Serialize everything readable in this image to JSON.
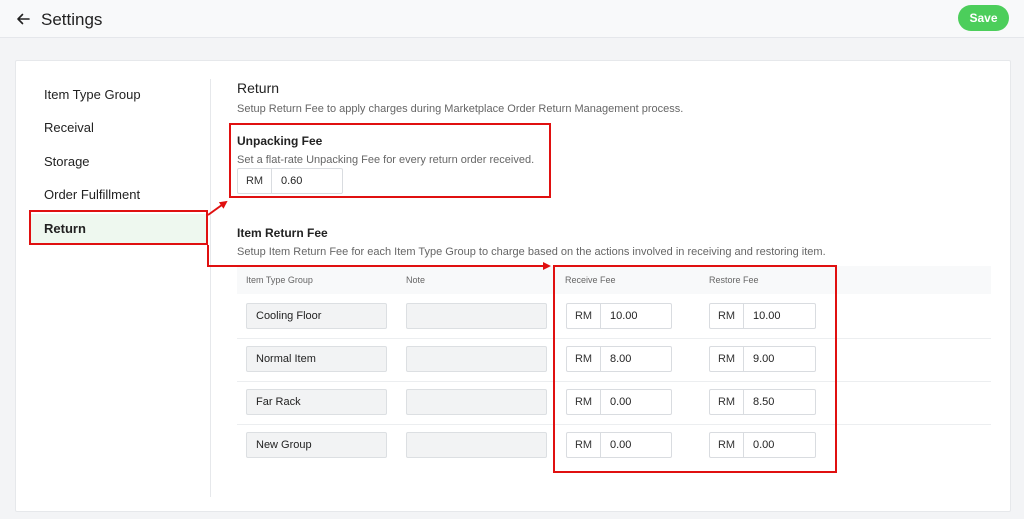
{
  "header": {
    "title": "Settings",
    "save_label": "Save"
  },
  "sidebar": {
    "items": [
      {
        "label": "Item Type Group"
      },
      {
        "label": "Receival"
      },
      {
        "label": "Storage"
      },
      {
        "label": "Order Fulfillment"
      },
      {
        "label": "Return"
      }
    ],
    "active": "Return"
  },
  "return": {
    "title": "Return",
    "description": "Setup Return Fee to apply charges during Marketplace Order Return Management process.",
    "unpacking_fee": {
      "title": "Unpacking Fee",
      "description": "Set a flat-rate Unpacking Fee for every return order received.",
      "currency": "RM",
      "value": "0.60"
    },
    "item_return_fee": {
      "title": "Item Return Fee",
      "description": "Setup Item Return Fee for each Item Type Group to charge based on the actions involved in receiving and restoring item.",
      "columns": [
        "Item Type Group",
        "Note",
        "Receive Fee",
        "Restore Fee"
      ],
      "currency": "RM",
      "rows": [
        {
          "group": "Cooling Floor",
          "note": "",
          "receive_fee": "10.00",
          "restore_fee": "10.00"
        },
        {
          "group": "Normal Item",
          "note": "",
          "receive_fee": "8.00",
          "restore_fee": "9.00"
        },
        {
          "group": "Far Rack",
          "note": "",
          "receive_fee": "0.00",
          "restore_fee": "8.50"
        },
        {
          "group": "New Group",
          "note": "",
          "receive_fee": "0.00",
          "restore_fee": "0.00"
        }
      ]
    }
  },
  "colors": {
    "accent_green": "#4cce5b",
    "highlight_red": "#e01010",
    "active_bg": "#eef8ef"
  }
}
